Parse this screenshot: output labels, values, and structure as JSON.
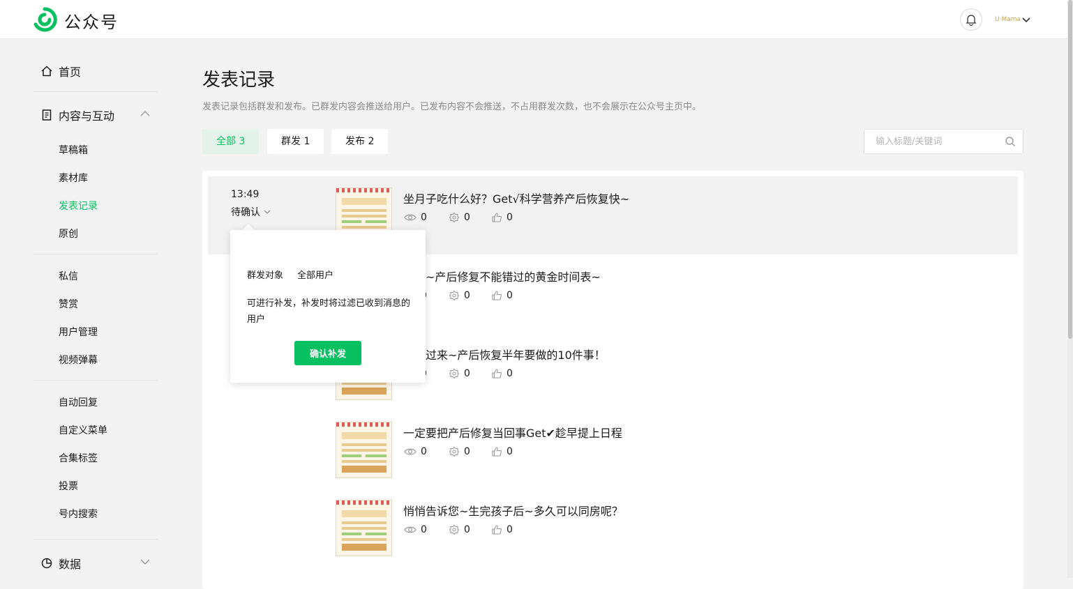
{
  "app": {
    "brand": "公众号",
    "avatar_text": "U·Mama"
  },
  "sidebar": {
    "home": "首页",
    "content_group": "内容与互动",
    "content_items": [
      "草稿箱",
      "素材库",
      "发表记录",
      "原创"
    ],
    "message_items": [
      "私信",
      "赞赏",
      "用户管理",
      "视频弹幕"
    ],
    "feature_items": [
      "自动回复",
      "自定义菜单",
      "合集标签",
      "投票",
      "号内搜索"
    ],
    "data_group": "数据",
    "active_item": "发表记录"
  },
  "main": {
    "title": "发表记录",
    "description": "发表记录包括群发和发布。已群发内容会推送给用户。已发布内容不会推送，不占用群发次数，也不会展示在公众号主页中。",
    "tabs": [
      {
        "label": "全部 3",
        "active": true
      },
      {
        "label": "群发 1",
        "active": false
      },
      {
        "label": "发布 2",
        "active": false
      }
    ],
    "search": {
      "placeholder": "输入标题/关键词",
      "value": ""
    },
    "record": {
      "time": "13:49",
      "status": "待确认"
    },
    "articles": [
      {
        "title": "坐月子吃什么好？Get√科学营养产后恢复快~",
        "views": "0",
        "shares": "0",
        "likes": "0"
      },
      {
        "title": "专属~产后修复不能错过的黄金时间表~",
        "views": "0",
        "shares": "0",
        "likes": "0"
      },
      {
        "title": "们看过来~产后恢复半年要做的10件事！",
        "views": "0",
        "shares": "0",
        "likes": "0"
      },
      {
        "title": "一定要把产后修复当回事Get✔趁早提上日程",
        "views": "0",
        "shares": "0",
        "likes": "0"
      },
      {
        "title": "悄悄告诉您~生完孩子后~多久可以同房呢？",
        "views": "0",
        "shares": "0",
        "likes": "0"
      }
    ]
  },
  "popover": {
    "target_label": "群发对象",
    "target_value": "全部用户",
    "note": "可进行补发，补发时将过滤已收到消息的用户",
    "confirm_button": "确认补发"
  },
  "colors": {
    "accent": "#07c160",
    "tab_active_bg": "#e3f3e9",
    "background": "#f3f3f3"
  }
}
